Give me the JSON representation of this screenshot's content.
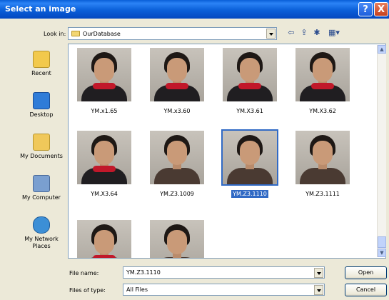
{
  "window": {
    "title": "Select an image",
    "help_label": "?",
    "close_label": "X"
  },
  "toolbar": {
    "lookin_label": "Look in:",
    "lookin_value": "OurDatabase",
    "back_glyph": "⇦",
    "up_glyph": "⇪",
    "newfolder_glyph": "✱",
    "views_glyph": "▦▾"
  },
  "places": [
    {
      "label": "Recent",
      "icon": "recent-folder-icon",
      "color": "#f2c94c"
    },
    {
      "label": "Desktop",
      "icon": "desktop-icon",
      "color": "#2f7cd8"
    },
    {
      "label": "My Documents",
      "icon": "my-documents-icon",
      "color": "#f0c85a"
    },
    {
      "label": "My Computer",
      "icon": "my-computer-icon",
      "color": "#7a9fd0"
    },
    {
      "label": "My Network Places",
      "icon": "network-places-icon",
      "color": "#3c8fd6"
    }
  ],
  "files": [
    {
      "name": "YM.x1.65",
      "selected": false
    },
    {
      "name": "YM.x3.60",
      "selected": false
    },
    {
      "name": "YM.X3.61",
      "selected": false
    },
    {
      "name": "YM.X3.62",
      "selected": false
    },
    {
      "name": "YM.X3.64",
      "selected": false
    },
    {
      "name": "YM.Z3.1009",
      "selected": false
    },
    {
      "name": "YM.Z3.1110",
      "selected": true
    },
    {
      "name": "YM.Z3.1111",
      "selected": false
    },
    {
      "name": "",
      "selected": false
    },
    {
      "name": "",
      "selected": false
    }
  ],
  "filename": {
    "label": "File name:",
    "value": "YM.Z3.1110"
  },
  "filetype": {
    "label": "Files of type:",
    "value": "All Files"
  },
  "buttons": {
    "open": "Open",
    "cancel": "Cancel"
  },
  "colors": {
    "title_bar": "#0a5fd8",
    "selection": "#316ac5",
    "dialog_bg": "#ece9d8"
  }
}
